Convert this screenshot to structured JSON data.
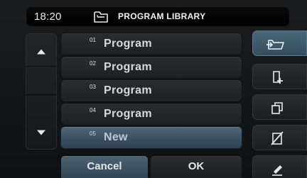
{
  "header": {
    "time": "18:20",
    "title": "PROGRAM LIBRARY",
    "icon": "folder-icon"
  },
  "left_column": {
    "scroll_up_icon": "arrow-up-icon",
    "scroll_down_icon": "arrow-down-icon"
  },
  "programs": [
    {
      "number": "01",
      "label": "Program"
    },
    {
      "number": "02",
      "label": "Program"
    },
    {
      "number": "03",
      "label": "Program"
    },
    {
      "number": "04",
      "label": "Program"
    },
    {
      "number": "05",
      "label": "New",
      "selected": true
    }
  ],
  "right_column": {
    "buttons": [
      "load-folder-icon",
      "new-document-icon",
      "copy-icon",
      "delete-icon",
      "edit-icon"
    ]
  },
  "footer": {
    "cancel_label": "Cancel",
    "ok_label": "OK"
  },
  "colors": {
    "accent": "#3f5868",
    "background": "#141517",
    "text": "#e6e6e6"
  }
}
